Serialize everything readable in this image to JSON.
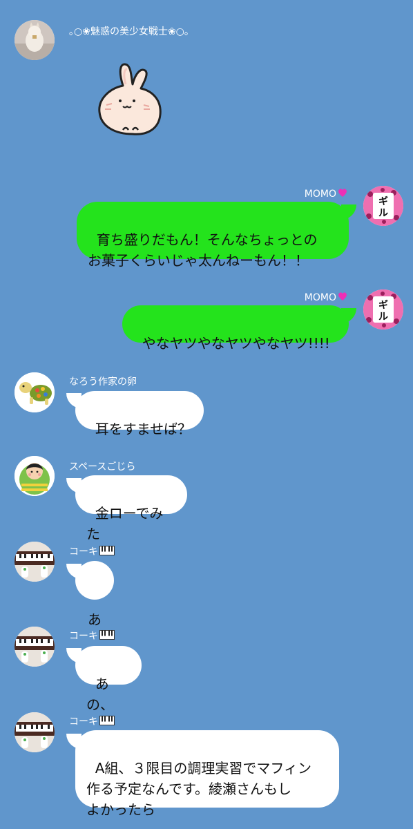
{
  "colors": {
    "background": "#6096cc",
    "bubble_white": "#ffffff",
    "bubble_green": "#24e31c",
    "name_text": "#ffffff"
  },
  "messages": [
    {
      "sender": "｡○❀魅惑の美少女戦士❀○｡",
      "type": "sticker",
      "sticker": "rabbit-sticker",
      "avatar": "cat-figurine-avatar"
    },
    {
      "sender": "MOMO",
      "sender_icon": "heart-icon",
      "side": "right",
      "text": "育ち盛りだもん！そんなちょっとの\nお菓子くらいじゃ太んねーもん！！",
      "avatar": "gyaru-avatar"
    },
    {
      "sender": "MOMO",
      "sender_icon": "heart-icon",
      "side": "right",
      "text": "やなヤツやなヤツやなヤツ!!!!",
      "avatar": "gyaru-avatar"
    },
    {
      "sender": "なろう作家の卵",
      "side": "left",
      "text": "耳をすませば？",
      "avatar": "turtle-avatar"
    },
    {
      "sender": "スペースごじら",
      "side": "left",
      "text": "金ローでみた",
      "avatar": "daruma-avatar"
    },
    {
      "sender": "コーキ",
      "sender_icon": "piano-icon",
      "side": "left",
      "text": "あ",
      "avatar": "piano-avatar"
    },
    {
      "sender": "コーキ",
      "sender_icon": "piano-icon",
      "side": "left",
      "text": "あの、",
      "avatar": "piano-avatar"
    },
    {
      "sender": "コーキ",
      "sender_icon": "piano-icon",
      "side": "left",
      "text": "A組、３限目の調理実習でマフィン\n作る予定なんです。綾瀬さんもし\nよかったら",
      "avatar": "piano-avatar"
    }
  ]
}
